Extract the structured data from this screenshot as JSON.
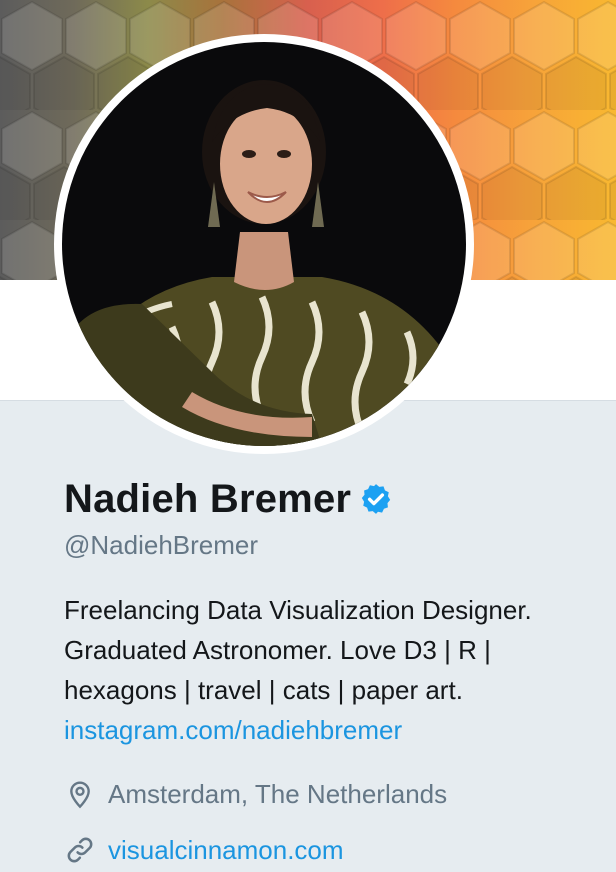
{
  "profile": {
    "name": "Nadieh Bremer",
    "handle": "@NadiehBremer",
    "verified": true,
    "bio_lines": [
      "Freelancing Data Visualization Designer.",
      "Graduated Astronomer. Love D3 | R |",
      "hexagons | travel | cats | paper art."
    ],
    "bio_link": "instagram.com/nadiehbremer",
    "location": "Amsterdam, The Netherlands",
    "website": "visualcinnamon.com"
  },
  "icons": {
    "verified": "verified-badge-icon",
    "location": "map-pin-icon",
    "website": "link-icon"
  },
  "colors": {
    "accent": "#1b95e0",
    "verified": "#1da1f2",
    "text_primary": "#14171a",
    "text_secondary": "#657786",
    "page_background": "#e6ecf0"
  }
}
